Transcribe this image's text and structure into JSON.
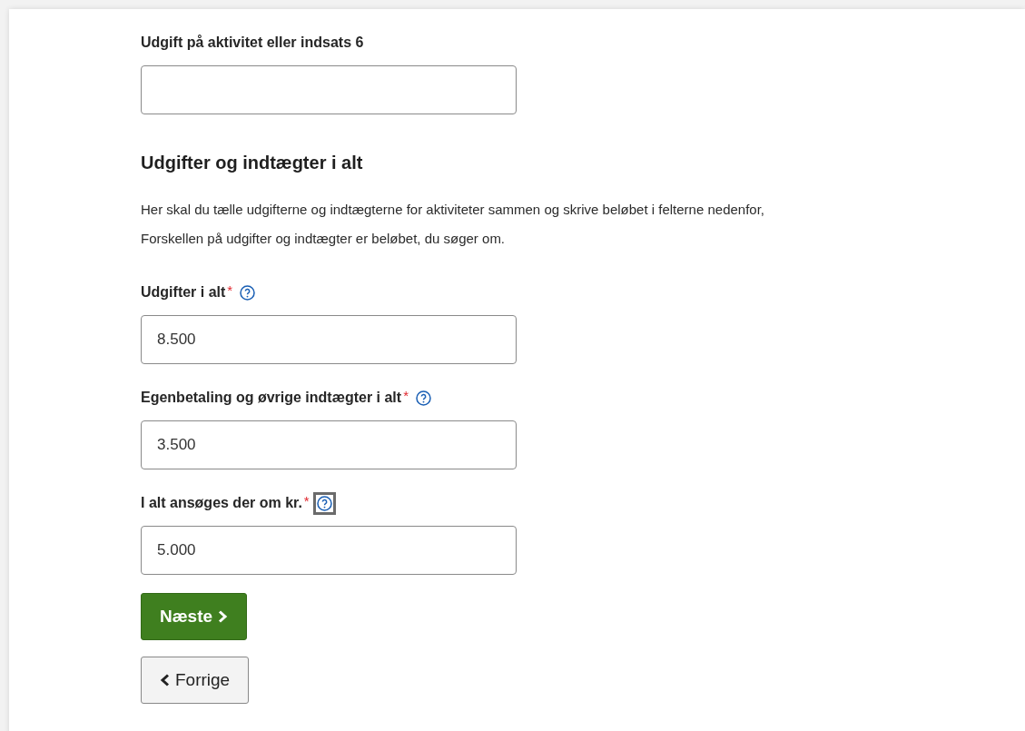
{
  "fields_top": [
    {
      "label": "Udgift på aktivitet eller indsats 6"
    }
  ],
  "section": {
    "heading": "Udgifter og indtægter i alt",
    "paragraph_lines": [
      "Her skal du tælle udgifterne og indtægterne for aktiviteter sammen og skrive beløbet i felterne nedenfor,",
      "Forskellen på udgifter og indtægter er beløbet, du søger om."
    ]
  },
  "fields": [
    {
      "label": "Udgifter i alt",
      "required_mark": "*",
      "help": true,
      "help_focused": false,
      "value": "8.500"
    },
    {
      "label": "Egenbetaling og øvrige indtægter i alt",
      "required_mark": "*",
      "help": true,
      "help_focused": false,
      "value": "3.500"
    },
    {
      "label": "I alt ansøges der om kr. ",
      "required_mark": "*",
      "help": true,
      "help_focused": true,
      "value": "5.000"
    }
  ],
  "buttons": [
    {
      "kind": "next",
      "label": "Næste"
    },
    {
      "kind": "previous",
      "label": "Forrige"
    }
  ]
}
